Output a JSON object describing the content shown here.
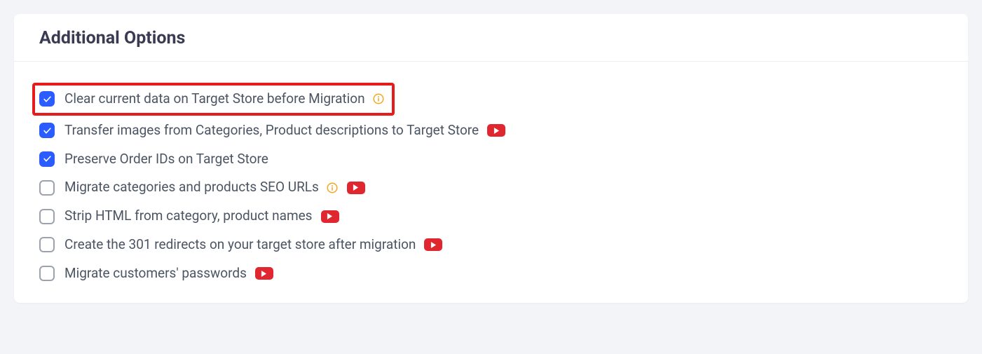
{
  "header": {
    "title": "Additional Options"
  },
  "options": {
    "clearData": {
      "label": "Clear current data on Target Store before Migration",
      "checked": true,
      "highlighted": true,
      "info": true,
      "video": false
    },
    "transferImages": {
      "label": "Transfer images from Categories, Product descriptions to Target Store",
      "checked": true,
      "highlighted": false,
      "info": false,
      "video": true
    },
    "preserveOrderIds": {
      "label": "Preserve Order IDs on Target Store",
      "checked": true,
      "highlighted": false,
      "info": false,
      "video": false
    },
    "migrateSeo": {
      "label": "Migrate categories and products SEO URLs",
      "checked": false,
      "highlighted": false,
      "info": true,
      "video": true
    },
    "stripHtml": {
      "label": "Strip HTML from category, product names",
      "checked": false,
      "highlighted": false,
      "info": false,
      "video": true
    },
    "redirects301": {
      "label": "Create the 301 redirects on your target store after migration",
      "checked": false,
      "highlighted": false,
      "info": false,
      "video": true
    },
    "migratePasswords": {
      "label": "Migrate customers' passwords",
      "checked": false,
      "highlighted": false,
      "info": false,
      "video": true
    }
  }
}
